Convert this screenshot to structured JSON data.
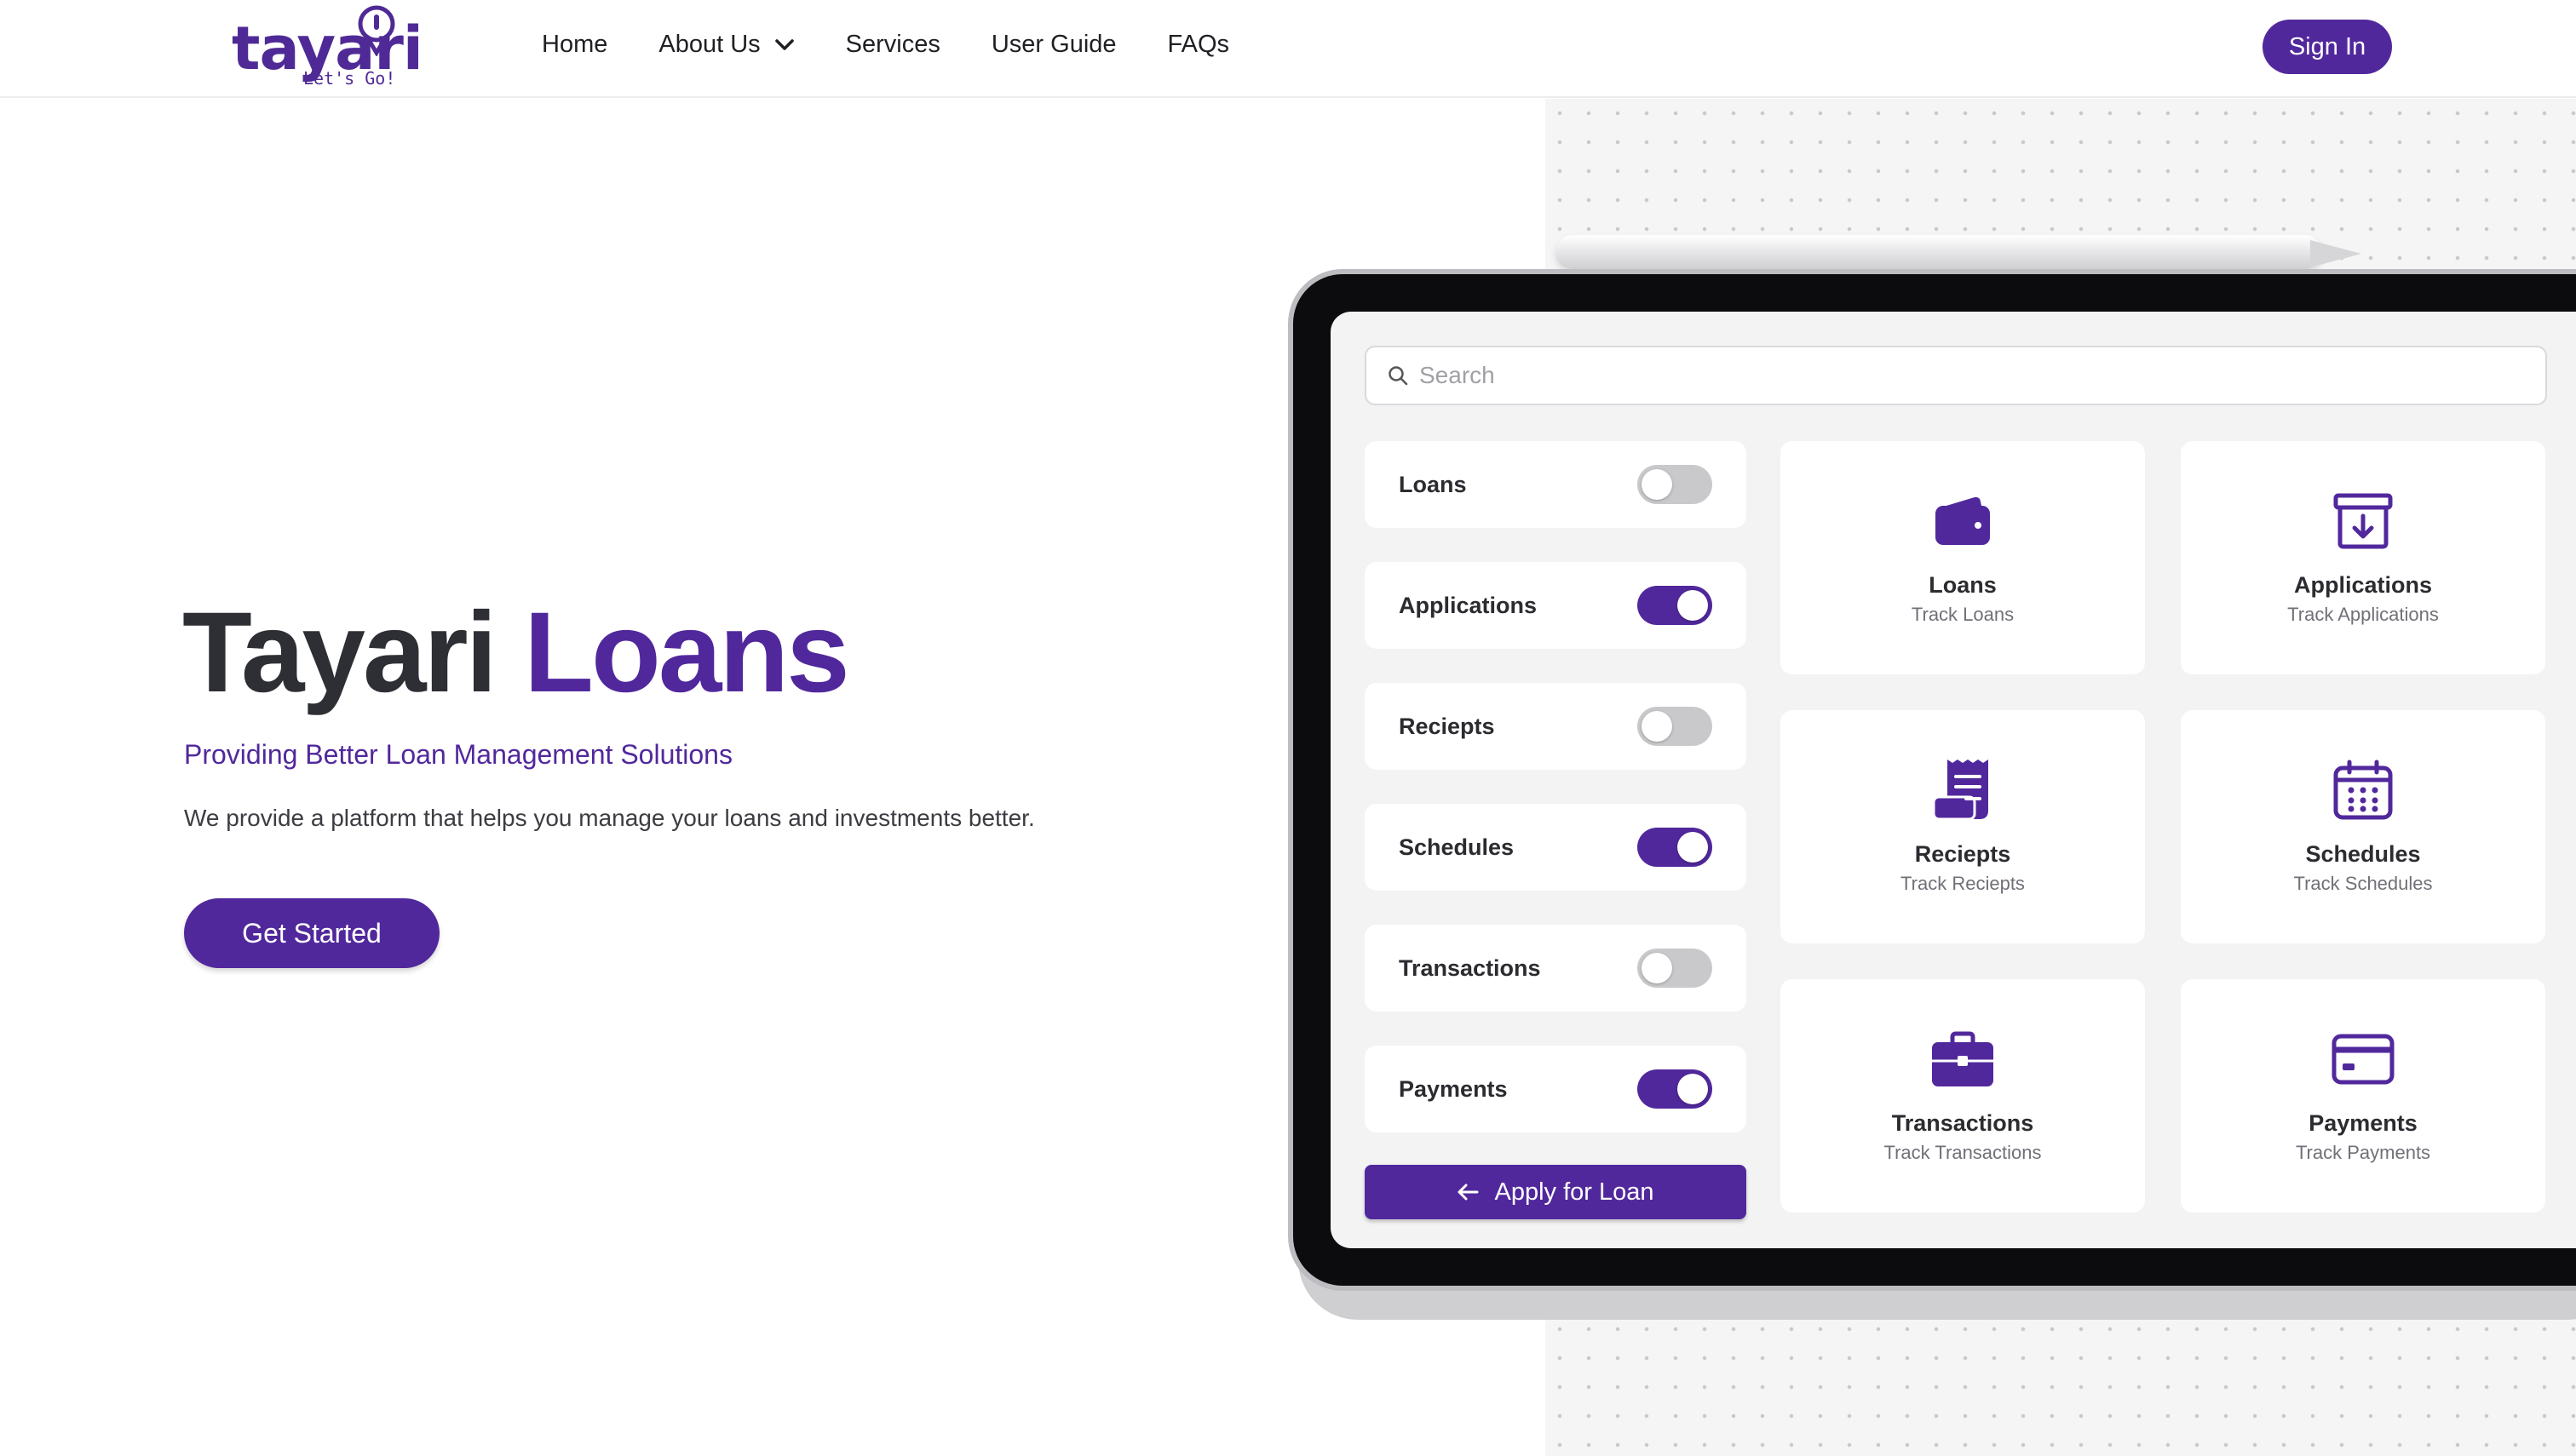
{
  "brand": {
    "name": "tayari",
    "tagline": "Let's Go!",
    "accent_color": "#51289c"
  },
  "nav": {
    "home": "Home",
    "about": "About Us",
    "services": "Services",
    "user_guide": "User Guide",
    "faqs": "FAQs",
    "sign_in": "Sign In"
  },
  "hero": {
    "title_part1": "Tayari",
    "title_part2": "Loans",
    "subtitle": "Providing Better Loan Management Solutions",
    "description": "We provide a platform that helps you manage your loans and investments better.",
    "cta": "Get Started"
  },
  "tablet": {
    "search_placeholder": "Search",
    "toggles": [
      {
        "label": "Loans",
        "on": false
      },
      {
        "label": "Applications",
        "on": true
      },
      {
        "label": "Reciepts",
        "on": false
      },
      {
        "label": "Schedules",
        "on": true
      },
      {
        "label": "Transactions",
        "on": false
      },
      {
        "label": "Payments",
        "on": true
      }
    ],
    "apply_button": "Apply for Loan",
    "cards": [
      {
        "title": "Loans",
        "subtitle": "Track Loans",
        "icon": "wallet-icon"
      },
      {
        "title": "Applications",
        "subtitle": "Track Applications",
        "icon": "archive-download-icon"
      },
      {
        "title": "Reciepts",
        "subtitle": "Track Reciepts",
        "icon": "receipt-icon"
      },
      {
        "title": "Schedules",
        "subtitle": "Track Schedules",
        "icon": "calendar-icon"
      },
      {
        "title": "Transactions",
        "subtitle": "Track Transactions",
        "icon": "briefcase-icon"
      },
      {
        "title": "Payments",
        "subtitle": "Track Payments",
        "icon": "credit-card-icon"
      }
    ]
  }
}
